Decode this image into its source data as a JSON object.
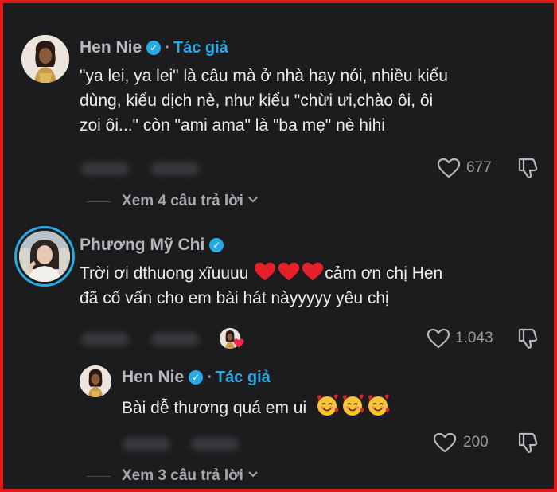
{
  "comments": [
    {
      "username": "Hen Nie",
      "badge": "Tác giả",
      "separator": "·",
      "lines": [
        "\"ya lei, ya lei\" là câu mà ở nhà hay nói, nhiều kiểu",
        "dùng, kiểu dịch nè, như kiểu \"chừi ưi,chào ôi, ôi",
        "zoi ôi...\" còn \"ami ama\" là \"ba mẹ\" nè hihi"
      ],
      "likes": "677",
      "view_replies": "Xem 4 câu trả lời"
    },
    {
      "username": "Phương Mỹ Chi",
      "line1_text": "Trời ơi dthuong xĩuuuu",
      "line1_after": "cảm ơn chị Hen",
      "line2": "đã cố vấn cho em bài hát nàyyyyy yêu chị",
      "likes": "1.043"
    },
    {
      "username": "Hen Nie",
      "badge": "Tác giả",
      "separator": "·",
      "text": "Bài dễ thương quá em ui",
      "likes": "200",
      "view_replies": "Xem 3 câu trả lời"
    }
  ],
  "icons": {
    "verified": "verified-check-icon",
    "heart": "heart-outline-icon",
    "dislike": "thumbs-down-icon",
    "red_heart": "red-heart-emoji",
    "smiling_hearts": "smiling-face-with-hearts-emoji",
    "chevron": "chevron-down-icon"
  },
  "colors": {
    "border": "#e01b1b",
    "background": "#1c1c1e",
    "accent": "#27a9e6"
  }
}
